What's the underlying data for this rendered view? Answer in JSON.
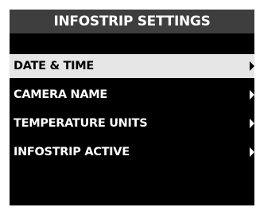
{
  "header": {
    "title": "INFOSTRIP SETTINGS"
  },
  "menu": {
    "selected_index": 0,
    "items": [
      {
        "label": "DATE & TIME"
      },
      {
        "label": "CAMERA NAME"
      },
      {
        "label": "TEMPERATURE UNITS"
      },
      {
        "label": "INFOSTRIP ACTIVE"
      }
    ]
  },
  "colors": {
    "background": "#000000",
    "header_bg": "#3e3e3e",
    "selected_bg": "#e6e6e6",
    "text": "#ffffff",
    "selected_text": "#000000"
  }
}
